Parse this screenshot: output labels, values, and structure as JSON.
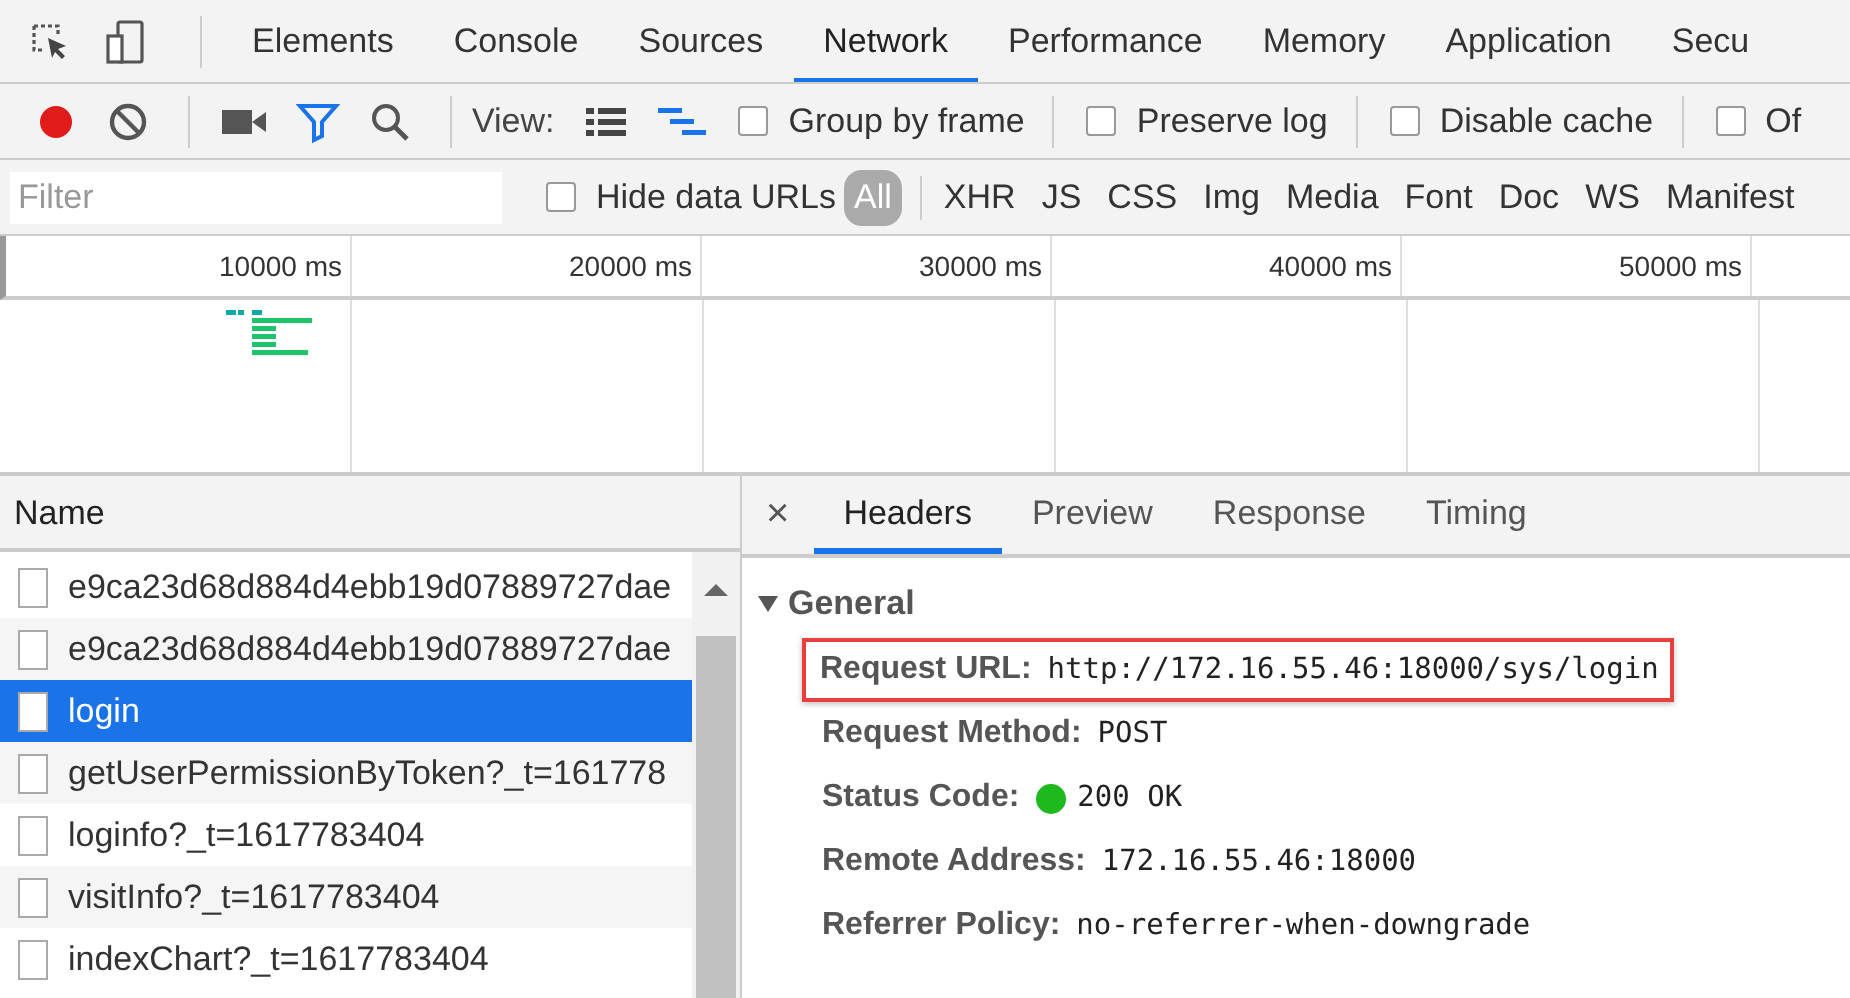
{
  "tabs": [
    {
      "label": "Elements",
      "selected": false
    },
    {
      "label": "Console",
      "selected": false
    },
    {
      "label": "Sources",
      "selected": false
    },
    {
      "label": "Network",
      "selected": true
    },
    {
      "label": "Performance",
      "selected": false
    },
    {
      "label": "Memory",
      "selected": false
    },
    {
      "label": "Application",
      "selected": false
    },
    {
      "label": "Secu",
      "selected": false
    }
  ],
  "toolbar": {
    "recording": true,
    "filter_on": true,
    "view_label": "View:",
    "large_rows": false,
    "overview": true,
    "checkboxes": [
      {
        "label": "Group by frame",
        "checked": false
      },
      {
        "label": "Preserve log",
        "checked": false
      },
      {
        "label": "Disable cache",
        "checked": false
      },
      {
        "label": "Of",
        "checked": false
      }
    ]
  },
  "filter_bar": {
    "placeholder": "Filter",
    "hide_data_urls": {
      "label": "Hide data URLs",
      "checked": false
    },
    "types": [
      {
        "label": "All",
        "selected": true
      },
      {
        "label": "XHR",
        "selected": false
      },
      {
        "label": "JS",
        "selected": false
      },
      {
        "label": "CSS",
        "selected": false
      },
      {
        "label": "Img",
        "selected": false
      },
      {
        "label": "Media",
        "selected": false
      },
      {
        "label": "Font",
        "selected": false
      },
      {
        "label": "Doc",
        "selected": false
      },
      {
        "label": "WS",
        "selected": false
      },
      {
        "label": "Manifest",
        "selected": false
      }
    ]
  },
  "timeline": {
    "ticks": [
      "10000 ms",
      "20000 ms",
      "30000 ms",
      "40000 ms",
      "50000 ms"
    ]
  },
  "requests": {
    "column": "Name",
    "rows": [
      {
        "name": "e9ca23d68d884d4ebb19d07889727dae",
        "selected": false
      },
      {
        "name": "e9ca23d68d884d4ebb19d07889727dae",
        "selected": false
      },
      {
        "name": "login",
        "selected": true
      },
      {
        "name": "getUserPermissionByToken?_t=161778",
        "selected": false
      },
      {
        "name": "loginfo?_t=1617783404",
        "selected": false
      },
      {
        "name": "visitInfo?_t=1617783404",
        "selected": false
      },
      {
        "name": "indexChart?_t=1617783404",
        "selected": false
      }
    ]
  },
  "detail": {
    "close": "×",
    "tabs": [
      {
        "label": "Headers",
        "selected": true
      },
      {
        "label": "Preview",
        "selected": false
      },
      {
        "label": "Response",
        "selected": false
      },
      {
        "label": "Timing",
        "selected": false
      }
    ],
    "section": {
      "title": "General",
      "expanded": true,
      "fields": [
        {
          "label": "Request URL:",
          "value": "http://172.16.55.46:18000/sys/login",
          "highlighted": true
        },
        {
          "label": "Request Method:",
          "value": "POST",
          "highlighted": false
        },
        {
          "label": "Status Code:",
          "value": "200 OK",
          "highlighted": false,
          "color": "#1db91d"
        },
        {
          "label": "Remote Address:",
          "value": "172.16.55.46:18000",
          "highlighted": false
        },
        {
          "label": "Referrer Policy:",
          "value": "no-referrer-when-downgrade",
          "highlighted": false
        }
      ]
    }
  }
}
